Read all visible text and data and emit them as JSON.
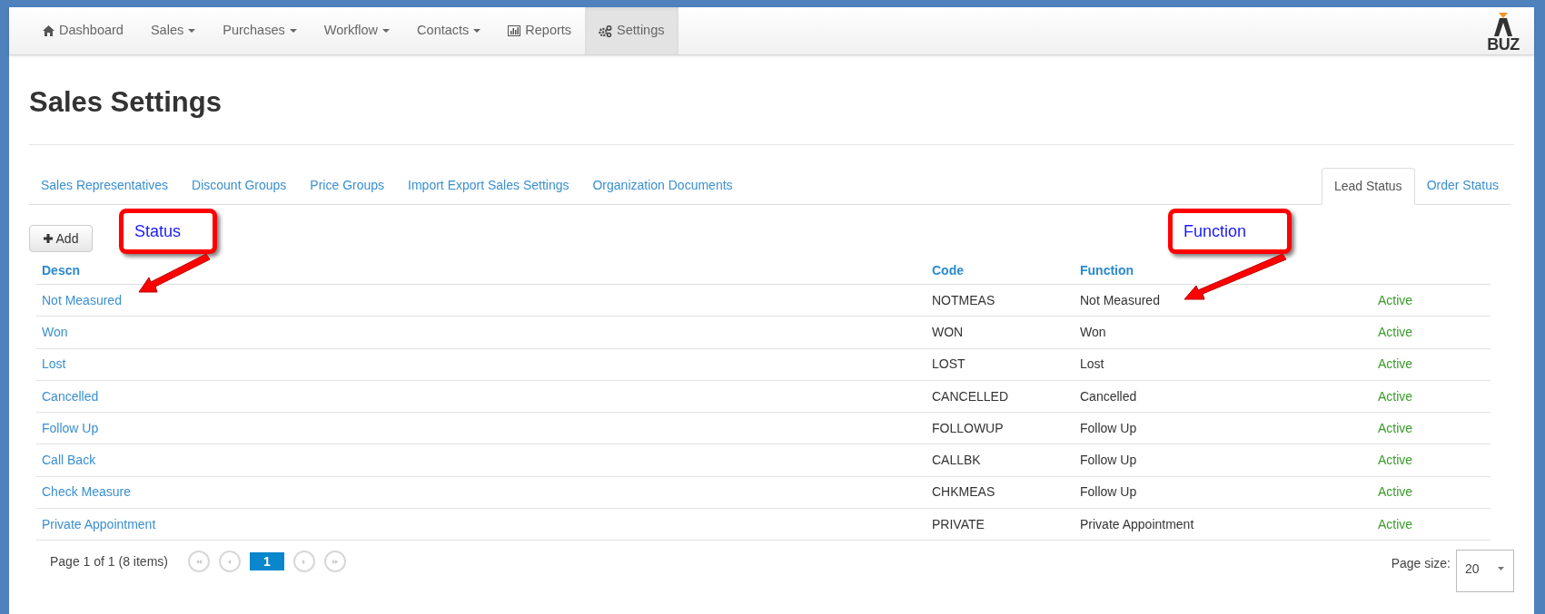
{
  "navbar": {
    "items": [
      {
        "label": "Dashboard",
        "kind": "link",
        "selected": false
      },
      {
        "label": "Sales",
        "kind": "dropdown",
        "selected": false
      },
      {
        "label": "Purchases",
        "kind": "dropdown",
        "selected": false
      },
      {
        "label": "Workflow",
        "kind": "dropdown",
        "selected": false
      },
      {
        "label": "Contacts",
        "kind": "dropdown",
        "selected": false
      },
      {
        "label": "Reports",
        "kind": "link",
        "selected": false
      },
      {
        "label": "Settings",
        "kind": "link",
        "selected": true
      }
    ],
    "logo_text": "BUZ"
  },
  "page_title": "Sales Settings",
  "tabs_left": [
    {
      "label": "Sales Representatives",
      "selected": false
    },
    {
      "label": "Discount Groups",
      "selected": false
    },
    {
      "label": "Price Groups",
      "selected": false
    },
    {
      "label": "Import Export Sales Settings",
      "selected": false
    },
    {
      "label": "Organization Documents",
      "selected": false
    }
  ],
  "tabs_right": [
    {
      "label": "Lead Status",
      "selected": true
    },
    {
      "label": "Order Status",
      "selected": false
    }
  ],
  "add_button": "Add",
  "table": {
    "columns": [
      "Descn",
      "Code",
      "Function"
    ],
    "rows": [
      {
        "descn": "Not Measured",
        "code": "NOTMEAS",
        "function": "Not Measured",
        "status": "Active"
      },
      {
        "descn": "Won",
        "code": "WON",
        "function": "Won",
        "status": "Active"
      },
      {
        "descn": "Lost",
        "code": "LOST",
        "function": "Lost",
        "status": "Active"
      },
      {
        "descn": "Cancelled",
        "code": "CANCELLED",
        "function": "Cancelled",
        "status": "Active"
      },
      {
        "descn": "Follow Up",
        "code": "FOLLOWUP",
        "function": "Follow Up",
        "status": "Active"
      },
      {
        "descn": "Call Back",
        "code": "CALLBK",
        "function": "Follow Up",
        "status": "Active"
      },
      {
        "descn": "Check Measure",
        "code": "CHKMEAS",
        "function": "Follow Up",
        "status": "Active"
      },
      {
        "descn": "Private Appointment",
        "code": "PRIVATE",
        "function": "Private Appointment",
        "status": "Active"
      }
    ]
  },
  "pager": {
    "info": "Page 1 of 1 (8 items)",
    "current_page": "1",
    "page_size_label": "Page size:",
    "page_size": "20"
  },
  "callouts": [
    {
      "text": "Status"
    },
    {
      "text": "Function"
    }
  ]
}
